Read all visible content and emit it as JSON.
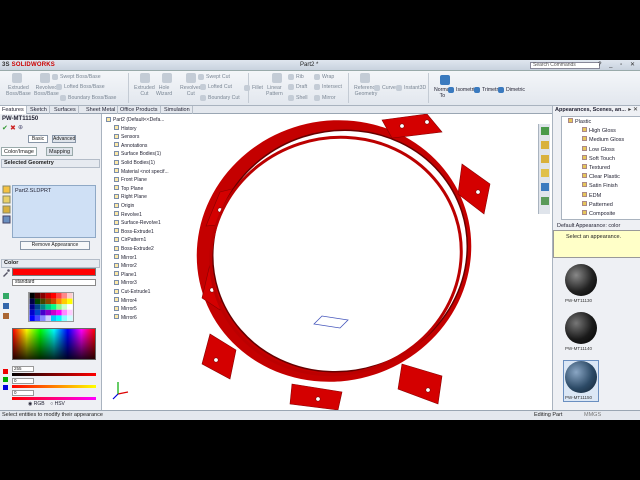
{
  "app": {
    "brand": "SOLIDWORKS",
    "title": "Part2 *",
    "search_placeholder": "Search Commands"
  },
  "ribbon": {
    "tools": [
      {
        "label": "Extruded\nBoss/Base",
        "active": false
      },
      {
        "label": "Revolved\nBoss/Base",
        "active": false
      },
      {
        "label": "Swept Boss/Base",
        "active": false
      },
      {
        "label": "Lofted Boss/Base",
        "active": false
      },
      {
        "label": "Boundary Boss/Base",
        "active": false
      },
      {
        "label": "Extruded\nCut",
        "active": false
      },
      {
        "label": "Hole\nWizard",
        "active": false
      },
      {
        "label": "Revolved\nCut",
        "active": false
      },
      {
        "label": "Swept Cut",
        "active": false
      },
      {
        "label": "Lofted Cut",
        "active": false
      },
      {
        "label": "Boundary Cut",
        "active": false
      },
      {
        "label": "Fillet",
        "active": false
      },
      {
        "label": "Linear\nPattern",
        "active": false
      },
      {
        "label": "Rib",
        "active": false
      },
      {
        "label": "Draft",
        "active": false
      },
      {
        "label": "Shell",
        "active": false
      },
      {
        "label": "Wrap",
        "active": false
      },
      {
        "label": "Intersect",
        "active": false
      },
      {
        "label": "Mirror",
        "active": false
      },
      {
        "label": "Reference\nGeometry",
        "active": false
      },
      {
        "label": "Curves",
        "active": false
      },
      {
        "label": "Instant3D",
        "active": false
      },
      {
        "label": "Normal\nTo",
        "active": true
      },
      {
        "label": "Isometric",
        "active": true
      },
      {
        "label": "Trimetric",
        "active": true
      },
      {
        "label": "Dimetric",
        "active": true
      }
    ]
  },
  "tabs": [
    "Features",
    "Sketch",
    "Surfaces",
    "Sheet Metal",
    "Office Products",
    "Simulation"
  ],
  "property_manager": {
    "title": "PW-MT11150",
    "basic_label": "Basic",
    "advanced_label": "Advanced",
    "tab_color": "Color/Image",
    "tab_mapping": "Mapping",
    "selected_geometry_header": "Selected Geometry",
    "selected_item": "Part2.SLDPRT",
    "remove_button": "Remove Appearance",
    "color_header": "Color",
    "current_color": "#ff0000",
    "color_mode_select": "standard",
    "r_value": "255",
    "g_value": "0",
    "b_value": "0",
    "mode_rgb": "RGB",
    "mode_hsv": "HSV"
  },
  "feature_tree": [
    "Part2  (Default<<Defa...",
    "History",
    "Sensors",
    "Annotations",
    "Surface Bodies(1)",
    "Solid Bodies(1)",
    "Material <not specif...",
    "Front Plane",
    "Top Plane",
    "Right Plane",
    "Origin",
    "Revolve1",
    "Surface-Revolve1",
    "Boss-Extrude1",
    "CirPattern1",
    "Boss-Extrude2",
    "Mirror1",
    "Mirror2",
    "Plane1",
    "Mirror3",
    "Cut-Extrude1",
    "Mirror4",
    "Mirror5",
    "Mirror6"
  ],
  "appearance_panel": {
    "title": "Appearances, Scenes, an...",
    "items": [
      "Plastic",
      "High Gloss",
      "Medium Gloss",
      "Low Gloss",
      "Soft Touch",
      "Textured",
      "Clear Plastic",
      "Satin Finish",
      "EDM",
      "Patterned",
      "Composite"
    ],
    "default_label": "Default Appearance: color",
    "tooltip": "Select an appearance.",
    "thumbnails": [
      {
        "label": "PW-MT11130",
        "color": "#222222"
      },
      {
        "label": "PW-MT11140",
        "color": "#1a1a1a"
      },
      {
        "label": "PW-MT11150",
        "color": "#2c4a66"
      }
    ]
  },
  "part_color": "#dd0000",
  "status": {
    "message": "Select entities to modify their appearance",
    "mode": "Editing Part",
    "units": "MMGS"
  }
}
